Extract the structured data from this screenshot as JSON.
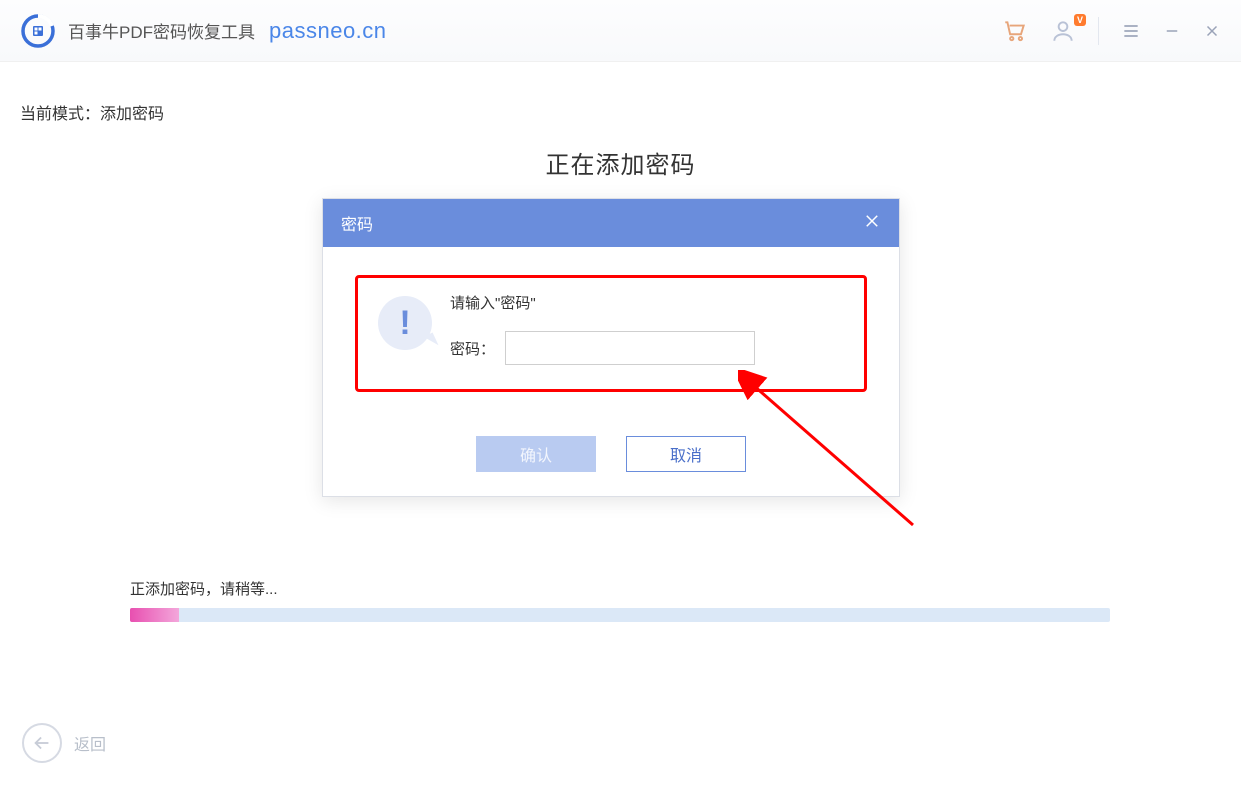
{
  "header": {
    "app_title": "百事牛PDF密码恢复工具",
    "domain": "passneo.cn"
  },
  "mode": {
    "label_prefix": "当前模式：",
    "value": "添加密码"
  },
  "main": {
    "title": "正在添加密码"
  },
  "dialog": {
    "title": "密码",
    "prompt": "请输入\"密码\"",
    "field_label": "密码：",
    "input_value": "",
    "confirm_label": "确认",
    "cancel_label": "取消"
  },
  "progress": {
    "label": "正添加密码，请稍等...",
    "percent": 5
  },
  "back": {
    "label": "返回"
  }
}
